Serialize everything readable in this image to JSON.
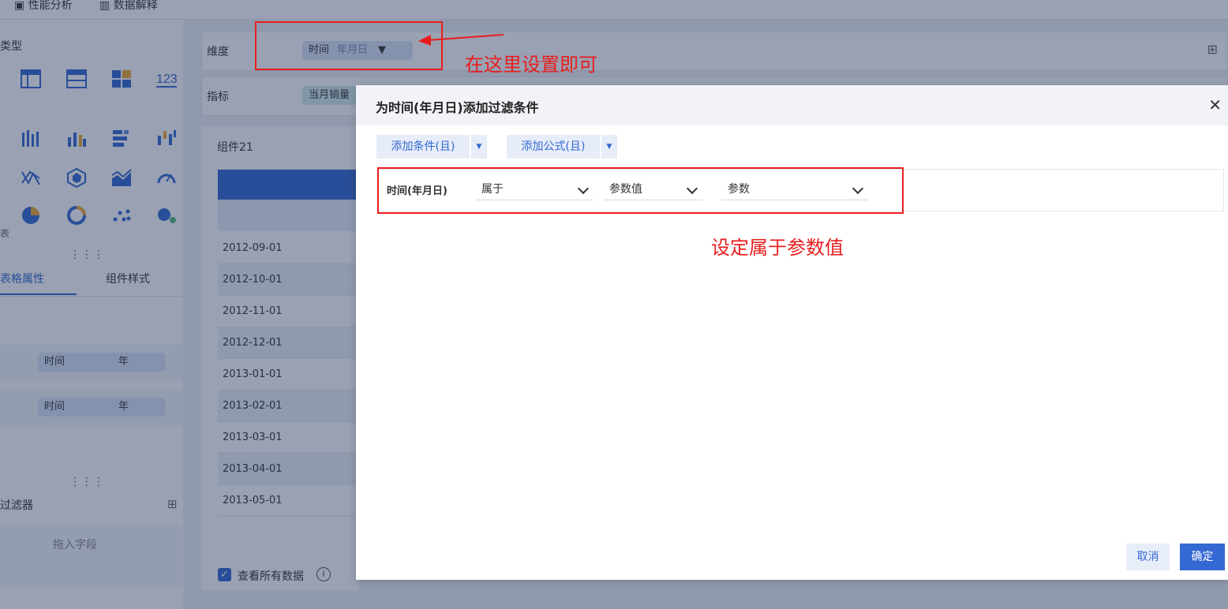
{
  "topbar": {
    "perf": "性能分析",
    "explain": "数据解释"
  },
  "left": {
    "type_title": "类型",
    "table_label": "表",
    "tabs": [
      "表格属性",
      "组件样式"
    ],
    "axis_pills": [
      {
        "name": "时间",
        "tag": "年"
      },
      {
        "name": "时间",
        "tag": "年"
      }
    ],
    "filter_title": "过滤器",
    "drop_hint": "拖入字段",
    "chart_type_icons": [
      "table-icon",
      "cross-table-icon",
      "grid-table-icon",
      "kpi-number-icon",
      "multi-bar-icon",
      "bar-icon",
      "stack-bar-icon",
      "range-bar-icon",
      "line-icon",
      "radar-icon",
      "area-icon",
      "gauge-icon",
      "pie-icon",
      "dashboard-icon",
      "scatter-icon",
      "bubble-icon"
    ]
  },
  "main": {
    "dimension_label": "维度",
    "dimension_pill": {
      "name": "时间",
      "tag": "年月日"
    },
    "metric_label": "指标",
    "metric_pill": "当月销量",
    "widget_title": "组件21",
    "dates": [
      "2012-09-01",
      "2012-10-01",
      "2012-11-01",
      "2012-12-01",
      "2013-01-01",
      "2013-02-01",
      "2013-03-01",
      "2013-04-01",
      "2013-05-01"
    ],
    "view_all": "查看所有数据"
  },
  "dialog": {
    "title": "为时间(年月日)添加过滤条件",
    "add_condition": "添加条件(且)",
    "add_formula": "添加公式(且)",
    "field": "时间(年月日)",
    "op": "属于",
    "value_type": "参数值",
    "param": "参数",
    "cancel": "取消",
    "ok": "确定"
  },
  "annotations": {
    "set_here": "在这里设置即可",
    "set_param": "设定属于参数值"
  },
  "colors": {
    "accent": "#3468d2",
    "annotation": "#e81e1e"
  }
}
